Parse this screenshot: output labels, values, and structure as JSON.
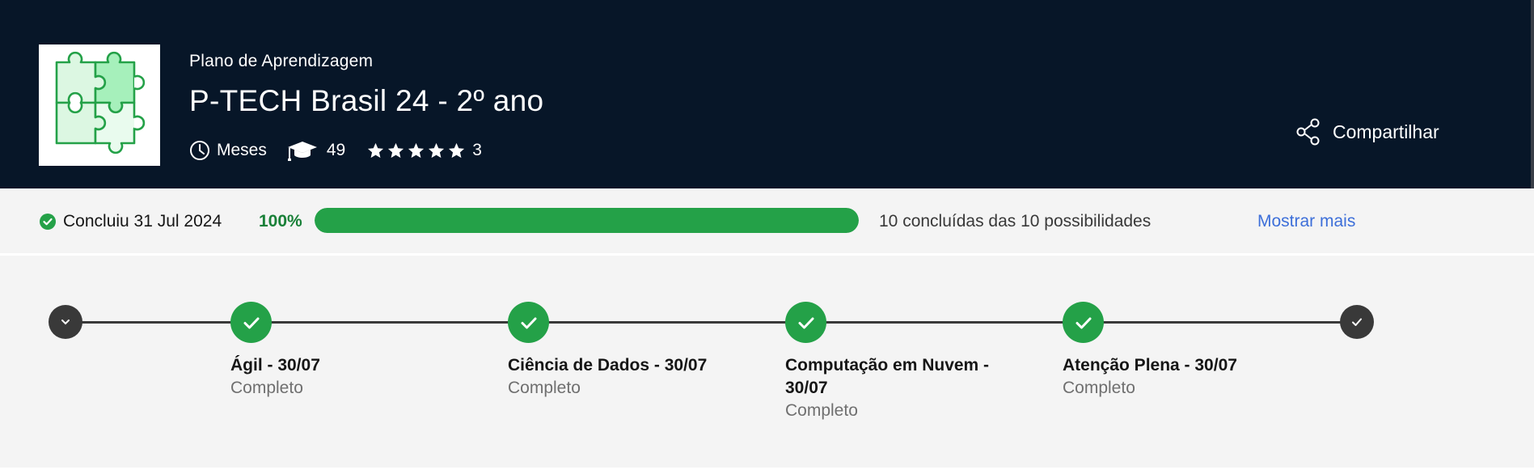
{
  "header": {
    "eyebrow": "Plano de Aprendizagem",
    "title": "P-TECH Brasil 24 - 2º ano",
    "duration_label": "Meses",
    "duration_icon": "clock-icon",
    "enrolled_count": "49",
    "enrolled_icon": "graduation-cap-icon",
    "rating_stars": 5,
    "rating_count": "3",
    "rating_icon": "star-icon",
    "share_label": "Compartilhar",
    "share_icon": "share-icon",
    "logo_icon": "puzzle-pieces-icon"
  },
  "progress": {
    "completed_label": "Concluiu 31 Jul 2024",
    "percent_label": "100%",
    "percent_value": 100,
    "counts_label": "10 concluídas das 10 possibilidades",
    "show_more_label": "Mostrar mais"
  },
  "timeline": {
    "steps": [
      {
        "title": "Ágil - 30/07",
        "status": "Completo"
      },
      {
        "title": "Ciência de Dados - 30/07",
        "status": "Completo"
      },
      {
        "title": "Computação em Nuvem - 30/07",
        "status": "Completo"
      },
      {
        "title": "Atenção Plena - 30/07",
        "status": "Completo"
      }
    ]
  },
  "colors": {
    "header_bg": "#071628",
    "success_green": "#24a148",
    "link_blue": "#3d6fd9",
    "node_dark": "#393939"
  }
}
